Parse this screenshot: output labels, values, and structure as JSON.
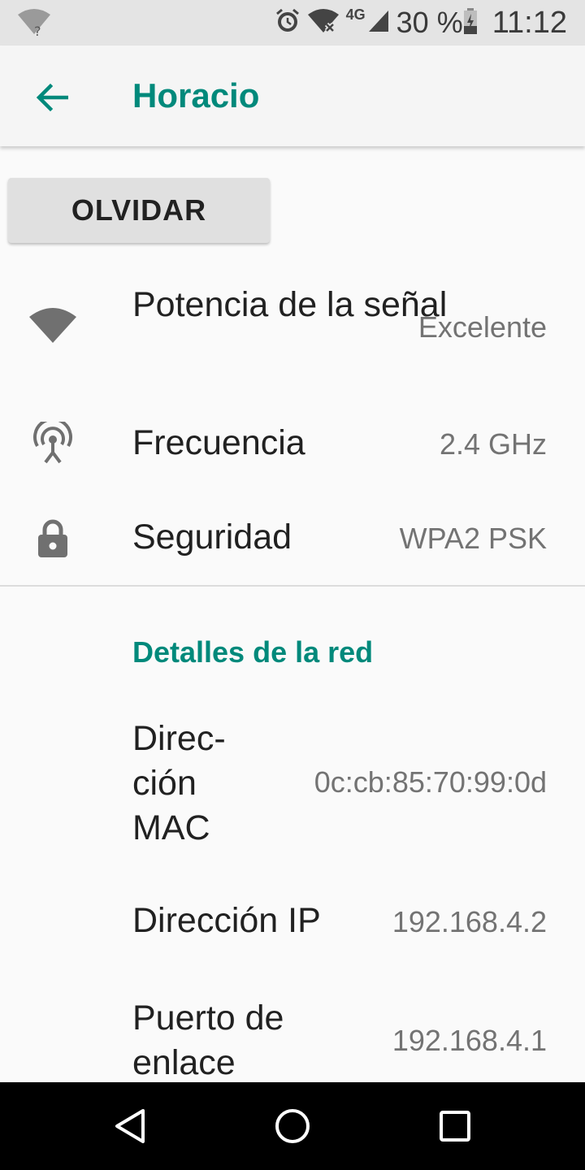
{
  "status_bar": {
    "battery_percent": "30 %",
    "network_type": "4G",
    "time": "11:12",
    "icons": [
      "wifi-question-icon",
      "alarm-icon",
      "wifi-x-icon",
      "cell-signal-icon",
      "battery-charging-icon"
    ]
  },
  "app_bar": {
    "title": "Horacio",
    "accent_color": "#00897b"
  },
  "actions": {
    "forget_label": "OLVIDAR"
  },
  "details": [
    {
      "icon": "wifi-signal-icon",
      "label": "Potencia de la señal",
      "value": "Excelente"
    },
    {
      "icon": "antenna-icon",
      "label": "Frecuencia",
      "value": "2.4 GHz"
    },
    {
      "icon": "lock-icon",
      "label": "Seguridad",
      "value": "WPA2 PSK"
    }
  ],
  "network_details": {
    "title": "Detalles de la red",
    "items": [
      {
        "label": "Direc-ción MAC",
        "label_lines": [
          "Direc-",
          "ción",
          "MAC"
        ],
        "value": "0c:cb:85:70:99:0d"
      },
      {
        "label": "Dirección IP",
        "label_lines": [
          "Dirección IP"
        ],
        "value": "192.168.4.2"
      },
      {
        "label": "Puerto de enlace",
        "label_lines": [
          "Puerto de",
          "enlace"
        ],
        "value": "192.168.4.1"
      }
    ]
  },
  "nav_bar": {
    "icons": [
      "back-triangle-icon",
      "home-circle-icon",
      "recents-square-icon"
    ]
  }
}
